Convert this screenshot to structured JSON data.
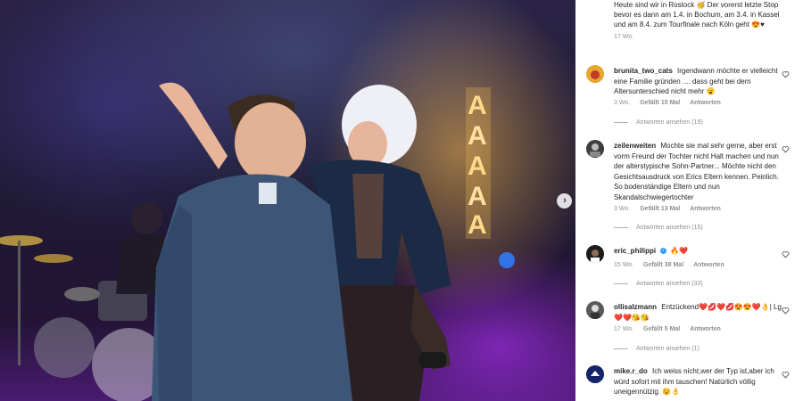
{
  "media": {
    "stage_sign_letters": [
      "A",
      "A",
      "A",
      "A",
      "A"
    ],
    "next_icon": "chevron-right-icon",
    "colors": {
      "stage_purple": "#7a2fd0",
      "spot_orange": "#ffb34a"
    }
  },
  "caption": {
    "text": "Heute sind wir in Rostock 🥳 Der vorerst letzte Stop bevor es dann am 1.4. in Bochum, am 3.4. in Kassel und am 8.4. zum Tourfinale nach Köln geht 😍♥",
    "age": "17 Wo."
  },
  "comments": [
    {
      "user": "brunita_two_cats",
      "text": "Irgendwann möchte er vielleicht eine Familie gründen .... dass geht bei dem Altersunterschied nicht mehr 😮",
      "age": "3 Wo.",
      "likes": "Gefällt 15 Mal",
      "reply": "Antworten",
      "view_replies": "Antworten ansehen (19)"
    },
    {
      "user": "zeilenweiten",
      "text": "Mochte sie mal sehr gerne, aber erst vorm Freund der Tochter nicht Halt machen und nun der alterstypische Sohn-Partner... Möchte nicht den Gesichtsausdruck von Erics Eltern kennen. Peinlich. So bodenständige Eltern und nun Skandalschwiegertochter",
      "age": "3 Wo.",
      "likes": "Gefällt 13 Mal",
      "reply": "Antworten",
      "view_replies": "Antworten ansehen (15)"
    },
    {
      "user": "eric_philippi",
      "verified": true,
      "text": "🔥❤️",
      "age": "15 Wo.",
      "likes": "Gefällt 38 Mal",
      "reply": "Antworten",
      "view_replies": "Antworten ansehen (33)"
    },
    {
      "user": "ollisalzmann",
      "text": "Entzückend❤️💋❤️💋😍😍❤️👌| Lg❤️❤️😘😘",
      "age": "17 Wo.",
      "likes": "Gefällt 5 Mal",
      "reply": "Antworten",
      "view_replies": "Antworten ansehen (1)"
    },
    {
      "user": "mike.r_do",
      "text": "Ich weiss nicht,wer der Typ ist,aber ich würd sofort mit ihm tauschen! Natürlich völlig uneigennützig. 😉👌",
      "age": "",
      "likes": "",
      "reply": "",
      "view_replies": ""
    }
  ],
  "icons": {
    "like": "heart-outline-icon"
  }
}
